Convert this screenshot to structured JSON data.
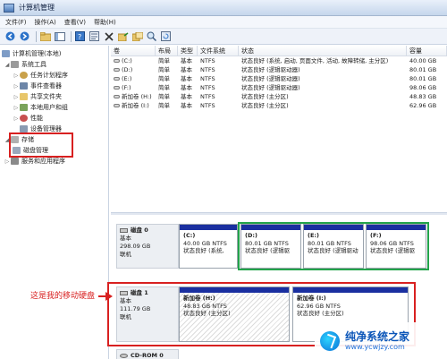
{
  "window": {
    "title": "计算机管理"
  },
  "menu": [
    "文件(F)",
    "操作(A)",
    "查看(V)",
    "帮助(H)"
  ],
  "toolbar": {
    "icons": [
      "back-icon",
      "forward-icon",
      "folder-up-icon",
      "show-hide-tree-icon",
      "help-icon",
      "properties-icon",
      "delete-icon",
      "export-icon",
      "copy-icon",
      "search-icon",
      "refresh-icon"
    ]
  },
  "tree": {
    "root": "计算机管理(本地)",
    "system_tools": "系统工具",
    "task_scheduler": "任务计划程序",
    "event_viewer": "事件查看器",
    "shared_folders": "共享文件夹",
    "local_users": "本地用户和组",
    "performance": "性能",
    "device_manager": "设备管理器",
    "storage": "存储",
    "disk_management": "磁盘管理",
    "services_apps": "服务和应用程序"
  },
  "volume_list": {
    "headers": [
      "卷",
      "布局",
      "类型",
      "文件系统",
      "状态",
      "容量"
    ],
    "rows": [
      [
        "(C:)",
        "简单",
        "基本",
        "NTFS",
        "状态良好 (系统, 启动, 页面文件, 活动, 故障转储, 主分区)",
        "40.00 GB"
      ],
      [
        "(D:)",
        "简单",
        "基本",
        "NTFS",
        "状态良好 (逻辑驱动器)",
        "80.01 GB"
      ],
      [
        "(E:)",
        "简单",
        "基本",
        "NTFS",
        "状态良好 (逻辑驱动器)",
        "80.01 GB"
      ],
      [
        "(F:)",
        "简单",
        "基本",
        "NTFS",
        "状态良好 (逻辑驱动器)",
        "98.06 GB"
      ],
      [
        "新加卷 (H:)",
        "简单",
        "基本",
        "NTFS",
        "状态良好 (主分区)",
        "48.83 GB"
      ],
      [
        "新加卷 (I:)",
        "简单",
        "基本",
        "NTFS",
        "状态良好 (主分区)",
        "62.96 GB"
      ]
    ]
  },
  "disks": [
    {
      "name": "磁盘 0",
      "type": "基本",
      "size": "298.09 GB",
      "status": "联机",
      "partitions": [
        {
          "name": "(C:)",
          "size": "40.00 GB NTFS",
          "status": "状态良好 (系统,"
        },
        {
          "name": "(D:)",
          "size": "80.01 GB NTFS",
          "status": "状态良好 (逻辑驱"
        },
        {
          "name": "(E:)",
          "size": "80.01 GB NTFS",
          "status": "状态良好 (逻辑驱动"
        },
        {
          "name": "(F:)",
          "size": "98.06 GB NTFS",
          "status": "状态良好 (逻辑驱"
        }
      ]
    },
    {
      "name": "磁盘 1",
      "type": "基本",
      "size": "111.79 GB",
      "status": "联机",
      "partitions": [
        {
          "name": "新加卷 (H:)",
          "size": "48.83 GB NTFS",
          "status": "状态良好 (主分区)"
        },
        {
          "name": "新加卷 (I:)",
          "size": "62.96 GB NTFS",
          "status": "状态良好 (主分区)"
        }
      ]
    },
    {
      "name": "CD-ROM 0"
    }
  ],
  "annotation": "这是我的移动硬盘",
  "watermark": {
    "title": "纯净系统之家",
    "url": "www.ycwjzy.com"
  },
  "colors": {
    "partition_bar": "#1a2fa0",
    "highlight_green": "#22a34a",
    "highlight_red": "#d82020",
    "titlebar": "#c5d6ec"
  }
}
